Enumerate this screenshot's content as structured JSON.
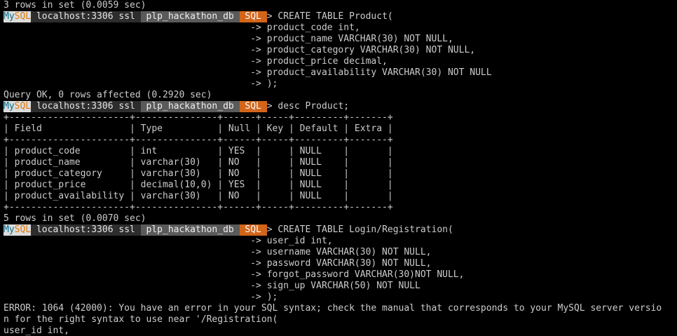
{
  "prompt": {
    "app_my": "My",
    "app_sql": "SQL",
    "host": "localhost:3306 ssl",
    "database": "plp_hackathon_db",
    "mode": "SQL",
    "arrow": ">"
  },
  "colors": {
    "background": "#000000",
    "text": "#cccccc",
    "mysql_segment_bg": "#dcdcdc",
    "mysql_my": "#0a6e8c",
    "mysql_sql": "#e07a10",
    "host_segment_bg": "#2d2d2d",
    "db_segment_bg": "#5a5a5a",
    "mode_segment_bg": "#d2651a"
  },
  "lines": [
    {
      "kind": "text",
      "text": "3 rows in set (0.0059 sec)"
    },
    {
      "kind": "prompt",
      "text": "CREATE TABLE Product("
    },
    {
      "kind": "cont",
      "text": "product_code int,"
    },
    {
      "kind": "cont",
      "text": "product_name VARCHAR(30) NOT NULL,"
    },
    {
      "kind": "cont",
      "text": "product_category VARCHAR(30) NOT NULL,"
    },
    {
      "kind": "cont",
      "text": "product_price decimal,"
    },
    {
      "kind": "cont",
      "text": "product_availability VARCHAR(30) NOT NULL"
    },
    {
      "kind": "cont",
      "text": ");"
    },
    {
      "kind": "text",
      "text": "Query OK, 0 rows affected (0.2920 sec)"
    },
    {
      "kind": "prompt",
      "text": "desc Product;"
    },
    {
      "kind": "text",
      "text": "+----------------------+---------------+------+-----+---------+-------+"
    },
    {
      "kind": "text",
      "text": "| Field                | Type          | Null | Key | Default | Extra |"
    },
    {
      "kind": "text",
      "text": "+----------------------+---------------+------+-----+---------+-------+"
    },
    {
      "kind": "text",
      "text": "| product_code         | int           | YES  |     | NULL    |       |"
    },
    {
      "kind": "text",
      "text": "| product_name         | varchar(30)   | NO   |     | NULL    |       |"
    },
    {
      "kind": "text",
      "text": "| product_category     | varchar(30)   | NO   |     | NULL    |       |"
    },
    {
      "kind": "text",
      "text": "| product_price        | decimal(10,0) | YES  |     | NULL    |       |"
    },
    {
      "kind": "text",
      "text": "| product_availability | varchar(30)   | NO   |     | NULL    |       |"
    },
    {
      "kind": "text",
      "text": "+----------------------+---------------+------+-----+---------+-------+"
    },
    {
      "kind": "text",
      "text": "5 rows in set (0.0070 sec)"
    },
    {
      "kind": "prompt",
      "text": "CREATE TABLE Login/Registration("
    },
    {
      "kind": "cont",
      "text": "user_id int,"
    },
    {
      "kind": "cont",
      "text": "username VARCHAR(30) NOT NULL,"
    },
    {
      "kind": "cont",
      "text": "password VARCHAR(30) NOT NULL,"
    },
    {
      "kind": "cont",
      "text": "forgot_password VARCHAR(30)NOT NULL,"
    },
    {
      "kind": "cont",
      "text": "sign_up VARCHAR(50) NOT NULL"
    },
    {
      "kind": "cont",
      "text": ");"
    },
    {
      "kind": "text",
      "text": "ERROR: 1064 (42000): You have an error in your SQL syntax; check the manual that corresponds to your MySQL server versio"
    },
    {
      "kind": "text",
      "text": "n for the right syntax to use near '/Registration("
    },
    {
      "kind": "text",
      "text": "user_id int,"
    }
  ]
}
